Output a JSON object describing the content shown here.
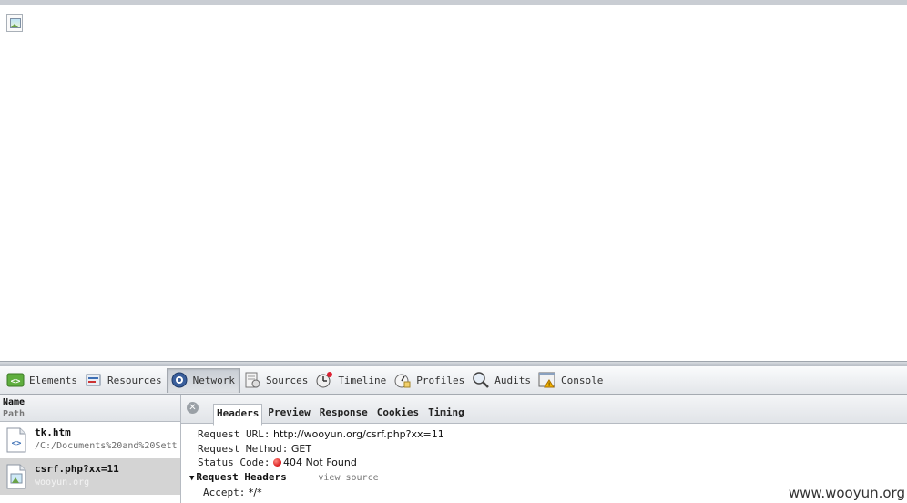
{
  "toolbar": {
    "items": [
      {
        "label": "Elements",
        "icon": "elements-icon"
      },
      {
        "label": "Resources",
        "icon": "resources-icon"
      },
      {
        "label": "Network",
        "icon": "network-icon",
        "active": true
      },
      {
        "label": "Sources",
        "icon": "sources-icon"
      },
      {
        "label": "Timeline",
        "icon": "timeline-icon"
      },
      {
        "label": "Profiles",
        "icon": "profiles-icon"
      },
      {
        "label": "Audits",
        "icon": "audits-icon"
      },
      {
        "label": "Console",
        "icon": "console-icon"
      }
    ]
  },
  "requests": {
    "header_name": "Name",
    "header_path": "Path",
    "rows": [
      {
        "name": "tk.htm",
        "path": "/C:/Documents%20and%20Sett",
        "icon": "html-file-icon"
      },
      {
        "name": "csrf.php?xx=11",
        "path": "wooyun.org",
        "icon": "image-file-icon",
        "selected": true
      }
    ]
  },
  "detail": {
    "tabs": [
      "Headers",
      "Preview",
      "Response",
      "Cookies",
      "Timing"
    ],
    "active_tab": "Headers",
    "request_url_label": "Request URL:",
    "request_url": "http://wooyun.org/csrf.php?xx=11",
    "request_method_label": "Request Method:",
    "request_method": "GET",
    "status_code_label": "Status Code:",
    "status_code": "404 Not Found",
    "request_headers_label": "Request Headers",
    "view_source": "view source",
    "accept_label": "Accept:",
    "accept_value": "*/*"
  },
  "watermark": "www.wooyun.org",
  "colors": {
    "status_error": "#d8181a",
    "selected_row": "#d4d4d4"
  }
}
